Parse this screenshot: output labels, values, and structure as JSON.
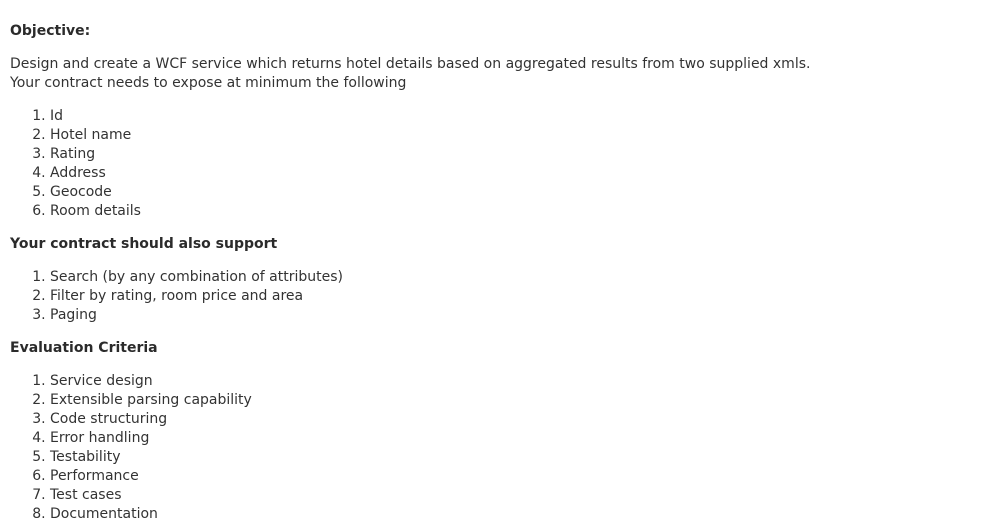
{
  "objective": {
    "heading": "Objective:",
    "description": "Design and create a WCF service which returns hotel details based on aggregated results from two supplied xmls. Your contract needs to expose at minimum the following",
    "items": [
      "Id",
      "Hotel name",
      "Rating",
      "Address",
      "Geocode",
      "Room details"
    ]
  },
  "contract_support": {
    "heading": "Your contract should also support",
    "items": [
      "Search (by any combination of attributes)",
      "Filter by rating, room price and area",
      "Paging"
    ]
  },
  "evaluation": {
    "heading": "Evaluation Criteria",
    "items": [
      "Service design",
      "Extensible parsing capability",
      "Code structuring",
      "Error handling",
      "Testability",
      "Performance",
      "Test cases",
      "Documentation"
    ]
  }
}
